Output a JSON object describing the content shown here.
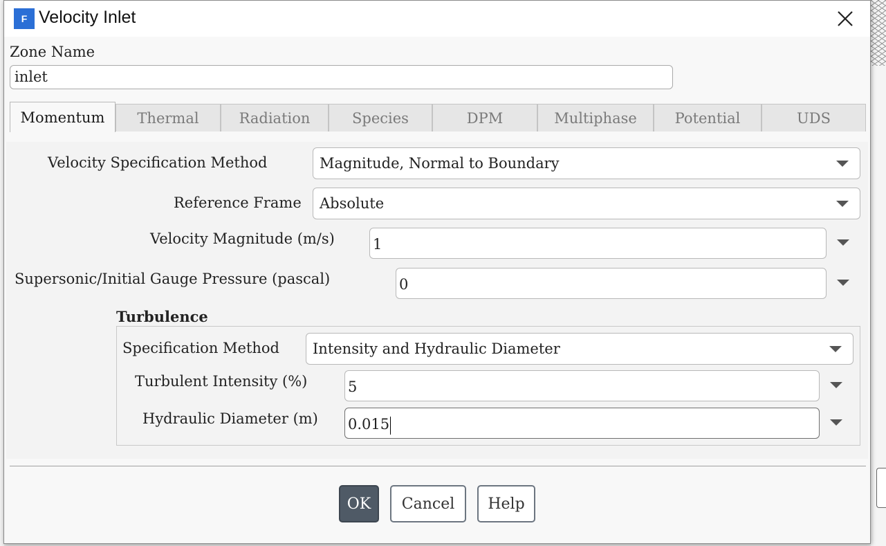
{
  "dialog": {
    "title": "Velocity Inlet",
    "app_icon_letter": "F",
    "zone_name_label": "Zone Name",
    "zone_name_value": "inlet"
  },
  "tabs": [
    {
      "label": "Momentum",
      "active": true
    },
    {
      "label": "Thermal",
      "active": false
    },
    {
      "label": "Radiation",
      "active": false
    },
    {
      "label": "Species",
      "active": false
    },
    {
      "label": "DPM",
      "active": false
    },
    {
      "label": "Multiphase",
      "active": false
    },
    {
      "label": "Potential",
      "active": false
    },
    {
      "label": "UDS",
      "active": false
    }
  ],
  "momentum": {
    "velocity_spec_label": "Velocity Specification Method",
    "velocity_spec_value": "Magnitude, Normal to Boundary",
    "reference_frame_label": "Reference Frame",
    "reference_frame_value": "Absolute",
    "velocity_magnitude_label": "Velocity Magnitude (m/s)",
    "velocity_magnitude_value": "1",
    "gauge_pressure_label": "Supersonic/Initial Gauge Pressure (pascal)",
    "gauge_pressure_value": "0"
  },
  "turbulence": {
    "heading": "Turbulence",
    "spec_method_label": "Specification Method",
    "spec_method_value": "Intensity and Hydraulic Diameter",
    "intensity_label": "Turbulent Intensity (%)",
    "intensity_value": "5",
    "diameter_label": "Hydraulic Diameter (m)",
    "diameter_value": "0.015"
  },
  "buttons": {
    "ok": "OK",
    "cancel": "Cancel",
    "help": "Help"
  },
  "colors": {
    "ok_button_bg": "#4f5a66",
    "app_icon_bg": "#2b6fd6"
  }
}
